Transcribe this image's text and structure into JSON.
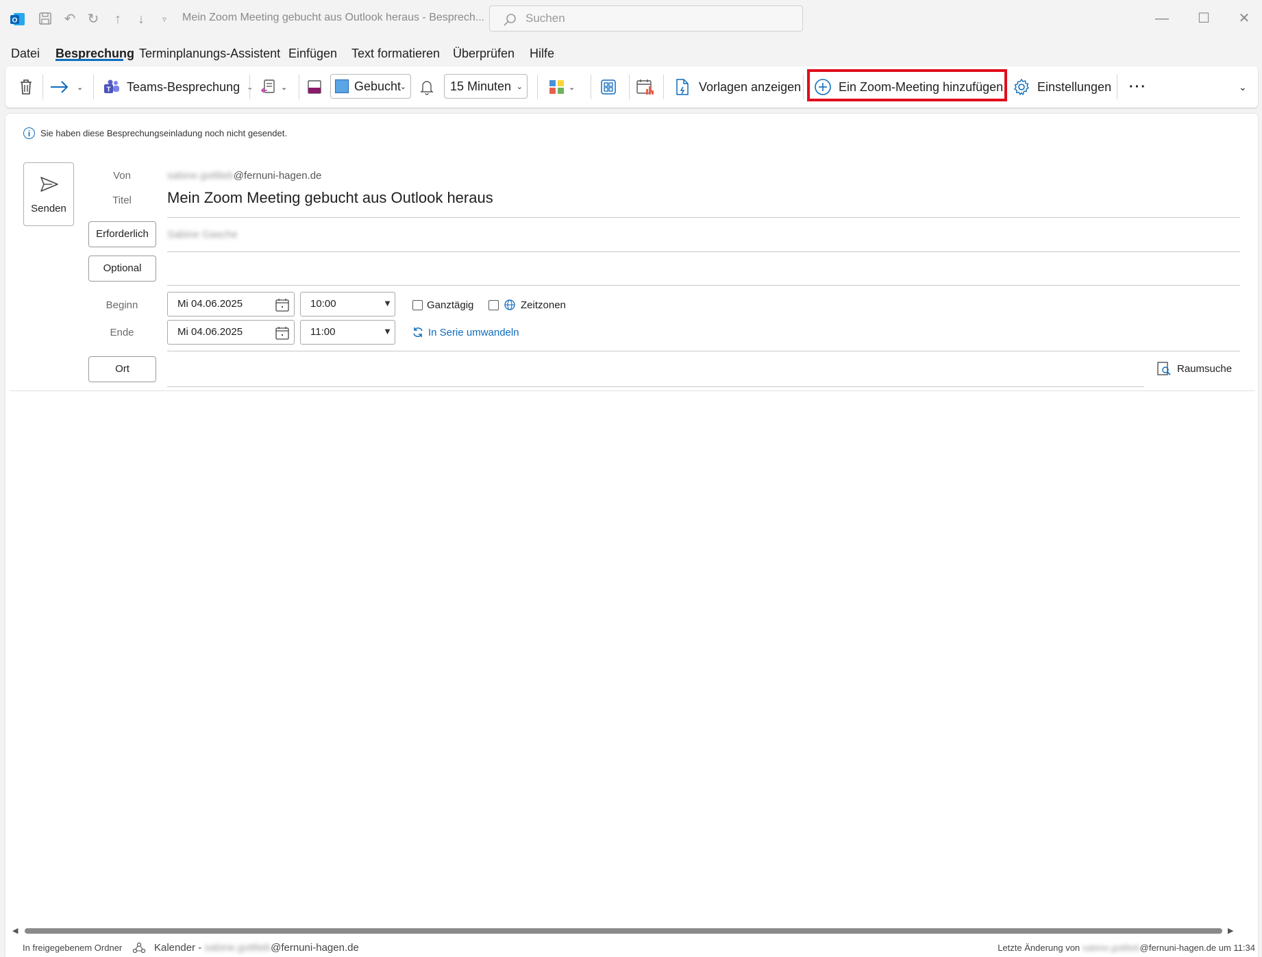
{
  "titlebar": {
    "window_title": "Mein Zoom Meeting gebucht aus Outlook heraus  -  Besprech...",
    "search_placeholder": "Suchen"
  },
  "menu": {
    "tabs": [
      "Datei",
      "Besprechung",
      "Terminplanungs-Assistent",
      "Einfügen",
      "Text formatieren",
      "Überprüfen",
      "Hilfe"
    ],
    "active": "Besprechung"
  },
  "ribbon": {
    "teams_label": "Teams-Besprechung",
    "status_value": "Gebucht",
    "reminder_value": "15 Minuten",
    "templates_label": "Vorlagen anzeigen",
    "zoom_label": "Ein Zoom-Meeting hinzufügen",
    "settings_label": "Einstellungen",
    "more_label": "···"
  },
  "form": {
    "info_text": "Sie haben diese Besprechungseinladung noch nicht gesendet.",
    "send_label": "Senden",
    "from_label": "Von",
    "from_user_blurred": "sabine.gottlieb",
    "from_domain": "@fernuni-hagen.de",
    "title_label": "Titel",
    "title_value": "Mein Zoom Meeting gebucht aus Outlook heraus",
    "required_label": "Erforderlich",
    "required_value_blurred": "Sabine Gasche",
    "optional_label": "Optional",
    "start_label": "Beginn",
    "end_label": "Ende",
    "start_date": "Mi 04.06.2025",
    "start_time": "10:00",
    "end_date": "Mi 04.06.2025",
    "end_time": "11:00",
    "allday_label": "Ganztägig",
    "timezones_label": "Zeitzonen",
    "recurrence_label": "In Serie umwandeln",
    "location_label": "Ort",
    "roomfinder_label": "Raumsuche"
  },
  "status": {
    "folder_label": "In freigegebenem Ordner",
    "calendar_prefix": "Kalender -",
    "calendar_user_blurred": "sabine.gottlieb",
    "calendar_domain": "@fernuni-hagen.de",
    "last_change_prefix": "Letzte Änderung von",
    "last_change_user_blurred": "sabine.gottlieb",
    "last_change_suffix": "@fernuni-hagen.de um 11:34"
  },
  "colors": {
    "accent": "#0f6cbd",
    "highlight": "#e00d1b",
    "outlook_blue": "#0364b8",
    "teams_purple": "#5b5fc7"
  }
}
